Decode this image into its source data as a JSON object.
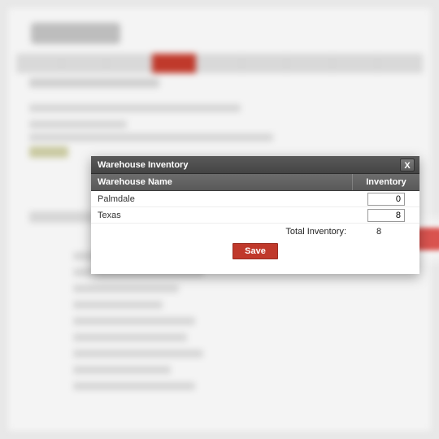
{
  "modal": {
    "title": "Warehouse Inventory",
    "close_glyph": "X",
    "columns": {
      "name": "Warehouse Name",
      "inventory": "Inventory"
    },
    "rows": [
      {
        "name": "Palmdale",
        "inventory": "0"
      },
      {
        "name": "Texas",
        "inventory": "8"
      }
    ],
    "total_label": "Total Inventory:",
    "total_value": "8",
    "save_label": "Save"
  }
}
